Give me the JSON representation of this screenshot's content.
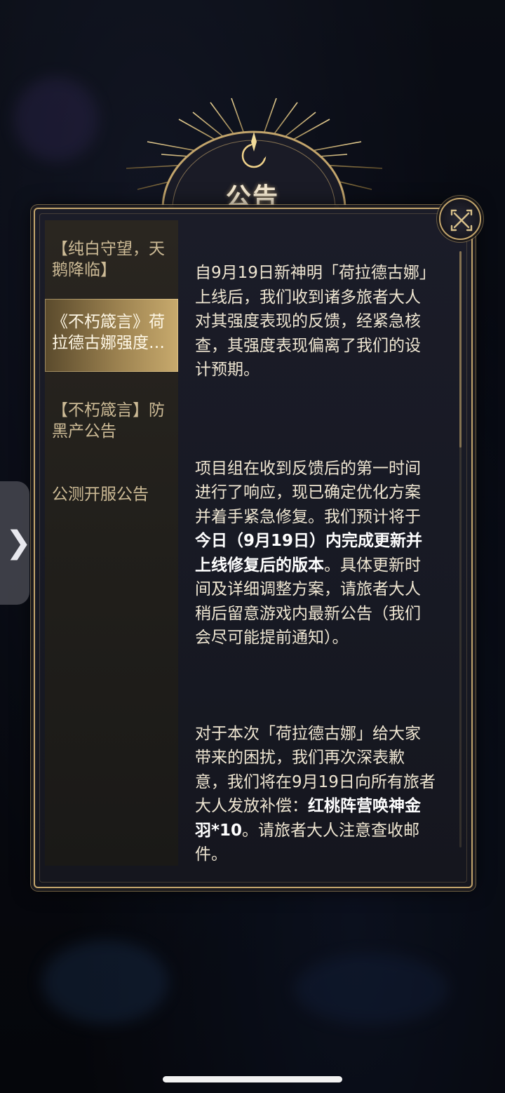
{
  "dialog": {
    "title": "公告",
    "close_icon": "close-x-icon"
  },
  "sidebar": {
    "items": [
      {
        "lines": [
          "【纯白守望，天",
          "鹅降临】"
        ],
        "active": false
      },
      {
        "lines": [
          "《不朽箴言》荷",
          "拉德古娜强度…"
        ],
        "active": true
      },
      {
        "lines": [
          "【不朽箴言】防",
          "黑产公告"
        ],
        "active": false
      },
      {
        "lines": [
          "公测开服公告"
        ],
        "active": false
      }
    ]
  },
  "article": {
    "p1": [
      "自9月19日新神明「荷拉德古娜」",
      "上线后，我们收到诸多旅者大人",
      "对其强度表现的反馈，经紧急核",
      "查，其强度表现偏离了我们的设",
      "计预期。"
    ],
    "p2": {
      "l1": "项目组在收到反馈后的第一时间",
      "l2": "进行了响应，现已确定优化方案",
      "l3": "并着手紧急修复。我们预计将于",
      "l4": "今日（9月19日）内完成更新并",
      "l5a": "上线修复后的版本",
      "l5b": "。具体更新时",
      "l6": "间及详细调整方案，请旅者大人",
      "l7": "稍后留意游戏内最新公告（我们",
      "l8": "会尽可能提前通知）。"
    },
    "p3": {
      "l1": "对于本次「荷拉德古娜」给大家",
      "l2": "带来的困扰，我们再次深表歉",
      "l3": "意，我们将在9月19日向所有旅者",
      "l4a": "大人发放补偿：",
      "l4b": "红桃阵营唤神金",
      "l5a": "羽*10",
      "l5b": "。请旅者大人注意查收邮",
      "l6": "件。"
    }
  },
  "edge_tab": {
    "icon": "chevron-right-icon",
    "glyph": "❯"
  },
  "colors": {
    "gold": "#c3a56c",
    "panel": "#1b1c28",
    "text": "#efe6d2"
  }
}
